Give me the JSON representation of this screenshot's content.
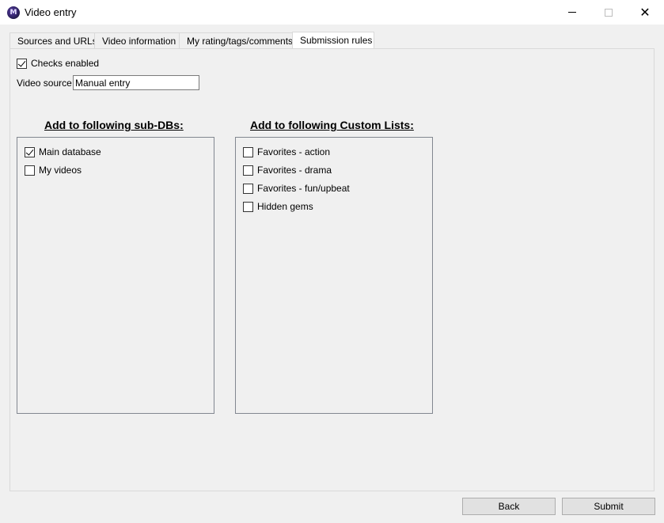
{
  "window": {
    "title": "Video entry",
    "icon_letter": "M",
    "minimize_glyph": "",
    "close_glyph": "✕"
  },
  "tabs": [
    {
      "label": "Sources and URLs",
      "active": false
    },
    {
      "label": "Video information",
      "active": false
    },
    {
      "label": "My rating/tags/comments",
      "active": false
    },
    {
      "label": "Submission rules",
      "active": true
    }
  ],
  "checks_enabled": {
    "label": "Checks enabled",
    "checked": true
  },
  "video_source": {
    "label": "Video source:",
    "value": "Manual entry"
  },
  "sub_dbs": {
    "heading": "Add to following sub-DBs:",
    "items": [
      {
        "label": "Main database",
        "checked": true
      },
      {
        "label": "My videos",
        "checked": false
      }
    ]
  },
  "custom_lists": {
    "heading": "Add to following Custom Lists:",
    "items": [
      {
        "label": "Favorites - action",
        "checked": false
      },
      {
        "label": "Favorites - drama",
        "checked": false
      },
      {
        "label": "Favorites - fun/upbeat",
        "checked": false
      },
      {
        "label": "Hidden gems",
        "checked": false
      }
    ]
  },
  "buttons": {
    "back": "Back",
    "submit": "Submit"
  }
}
